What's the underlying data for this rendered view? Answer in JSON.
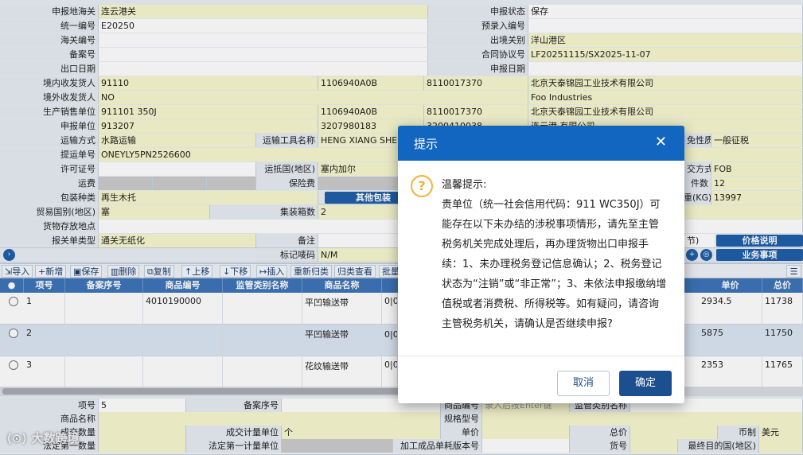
{
  "form": {
    "declare_customs_label": "申报地海关",
    "declare_customs_value": "连云港关",
    "declare_status_label": "申报状态",
    "declare_status_value": "保存",
    "unified_no_label": "统一编号",
    "unified_no_value": "E20250",
    "pre_entry_label": "预录入编号",
    "customs_no_label": "海关编号",
    "exit_port_label": "出境关别",
    "exit_port_value": "洋山港区",
    "record_no_label": "备案号",
    "contract_label": "合同协议号",
    "contract_value": "LF20251115/SX2025-11-07",
    "export_date_label": "出口日期",
    "declare_date_label": "申报日期",
    "domestic_consignor_label": "境内收发货人",
    "domestic_consignor_code": "91110",
    "domestic_consignor_cust": "1106940A0B",
    "domestic_consignor_ciq": "8110017370",
    "domestic_consignor_name": "北京天泰锦园工业技术有限公司",
    "overseas_consignee_label": "境外收发货人",
    "overseas_consignee_value": "NO",
    "overseas_consignee_name": "Foo    Industries",
    "producer_label": "生产销售单位",
    "producer_code": "911101      350J",
    "producer_cust": "1106940A0B",
    "producer_ciq": "8110017370",
    "producer_name": "北京天泰锦园工业技术有限公司",
    "declare_unit_label": "申报单位",
    "declare_unit_code": "913207",
    "declare_unit_cust": "3207980183",
    "declare_unit_ciq": "3200410038",
    "declare_unit_name": "连云港   有限公司",
    "transport_mode_label": "运输方式",
    "transport_mode_value": "水路运输",
    "transport_tool_label": "运输工具名称",
    "transport_tool_value": "HENG XIANG SHE",
    "tax_nature_label": "免性质",
    "tax_nature_value": "一般征税",
    "bill_label": "提运单号",
    "bill_value": "ONEYLY5PN2526600",
    "license_label": "许可证号",
    "dest_country_label": "运抵国(地区)",
    "dest_country_value": "塞内加尔",
    "deal_mode_label": "交方式",
    "deal_mode_value": "FOB",
    "freight_label": "运费",
    "insurance_label": "保险费",
    "pieces_label": "件数",
    "pieces_value": "12",
    "pack_label": "包装种类",
    "pack_value": "再生木托",
    "other_pack_button": "其他包装",
    "weight_label": "重(KG)",
    "weight_value": "13997",
    "trade_country_label": "贸易国别(地区)",
    "trade_country_value": "塞",
    "container_count_label": "集装箱数",
    "container_count_value": "2",
    "storage_label": "货物存放地点",
    "doc_type_label": "报关单类型",
    "doc_type_value": "通关无纸化",
    "remark_label": "备注",
    "mark_label": "标记唛码",
    "mark_value": "N/M",
    "price_desc_button": "价格说明",
    "business_button": "业务事项",
    "section_tail": "节)"
  },
  "toolbar": [
    "导入",
    "新增",
    "保存",
    "删除",
    "复制",
    "上移",
    "下移",
    "插入",
    "重新归类",
    "归类查看",
    "批量"
  ],
  "table": {
    "headers": [
      "项号",
      "备案序号",
      "商品编号",
      "监管类别名称",
      "商品名称",
      "单价",
      "总价"
    ],
    "rows": [
      {
        "no": "1",
        "code": "4010190000",
        "name": "平凹输送带",
        "spec": "0|0|",
        "price": "2934.5",
        "total": "11738"
      },
      {
        "no": "2",
        "code": "",
        "name": "平凹输送带",
        "spec": "0|0|胶",
        "price": "5875",
        "total": "11750"
      },
      {
        "no": "3",
        "code": "",
        "name": "花纹输送带",
        "spec": "0|0|",
        "price": "2353",
        "total": "11765"
      }
    ]
  },
  "lower": {
    "item_no_label": "项号",
    "item_no_value": "5",
    "record_seq_label": "备案序号",
    "hs_code_label": "商品编号",
    "hs_code_placeholder": "录入后按Enter键",
    "reg_cat_label": "监管类别名称",
    "goods_name_label": "商品名称",
    "spec_label": "规格型号",
    "deal_qty_label": "成交数量",
    "deal_unit_label": "成交计量单位",
    "deal_unit_value": "个",
    "unit_price_label": "单价",
    "total_price_label": "总价",
    "currency_label": "币制",
    "currency_value": "美元",
    "legal_qty_label": "法定第一数量",
    "legal_unit_label": "法定第一计量单位",
    "version_label": "加工成品单耗版本号",
    "goods_no_label": "货号",
    "final_dest_label": "最终目的国(地区)"
  },
  "dialog": {
    "title": "提示",
    "close": "✕",
    "heading": "温馨提示:",
    "body": "贵单位（统一社会信用代码：911        WC350J）可能存在以下未办结的涉税事项情形，请先至主管税务机关完成处理后，再办理货物出口申报手续：1、未办理税务登记信息确认；2、税务登记状态为“注销”或“非正常”；3、未依法申报缴纳增值税或者消费税、所得税等。如有疑问，请咨询主管税务机关，请确认是否继续申报?",
    "cancel": "取消",
    "ok": "确定"
  },
  "watermark": "大数跨境"
}
